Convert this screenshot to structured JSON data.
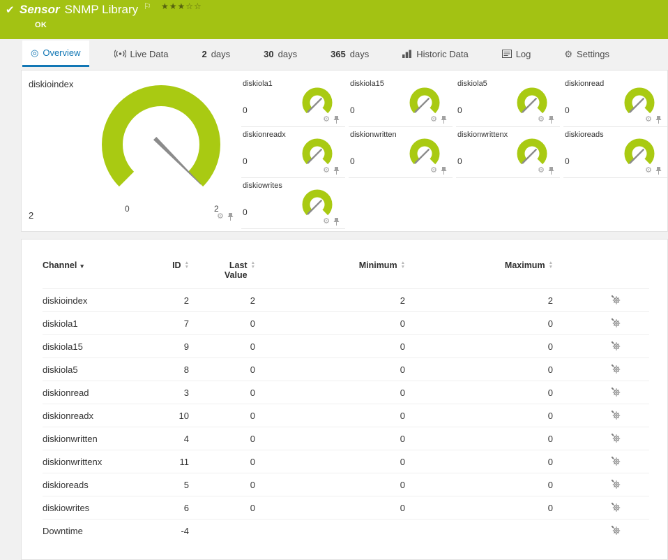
{
  "colors": {
    "header-bg": "#a3c213",
    "lime": "#a9ca12",
    "blue": "#1277b5"
  },
  "header": {
    "title_prefix": "Sensor",
    "title": "SNMP Library",
    "status": "OK",
    "rating_filled": 3,
    "rating_total": 5
  },
  "tabs": {
    "overview": "Overview",
    "live": "Live Data",
    "d2_num": "2",
    "d2": "days",
    "d30_num": "30",
    "d30": "days",
    "d365_num": "365",
    "d365": "days",
    "historic": "Historic Data",
    "log": "Log",
    "settings": "Settings"
  },
  "gauges": {
    "main": {
      "title": "diskioindex",
      "value": "2",
      "min": "0",
      "max": "2"
    },
    "small": [
      {
        "title": "diskiola1",
        "value": "0"
      },
      {
        "title": "diskiola15",
        "value": "0"
      },
      {
        "title": "diskiola5",
        "value": "0"
      },
      {
        "title": "diskionread",
        "value": "0"
      },
      {
        "title": "diskionreadx",
        "value": "0"
      },
      {
        "title": "diskionwritten",
        "value": "0"
      },
      {
        "title": "diskionwrittenx",
        "value": "0"
      },
      {
        "title": "diskioreads",
        "value": "0"
      },
      {
        "title": "diskiowrites",
        "value": "0"
      }
    ]
  },
  "table": {
    "columns": {
      "channel": "Channel",
      "id": "ID",
      "last": "Last Value",
      "min": "Minimum",
      "max": "Maximum"
    },
    "rows": [
      {
        "channel": "diskioindex",
        "id": "2",
        "last": "2",
        "min": "2",
        "max": "2"
      },
      {
        "channel": "diskiola1",
        "id": "7",
        "last": "0",
        "min": "0",
        "max": "0"
      },
      {
        "channel": "diskiola15",
        "id": "9",
        "last": "0",
        "min": "0",
        "max": "0"
      },
      {
        "channel": "diskiola5",
        "id": "8",
        "last": "0",
        "min": "0",
        "max": "0"
      },
      {
        "channel": "diskionread",
        "id": "3",
        "last": "0",
        "min": "0",
        "max": "0"
      },
      {
        "channel": "diskionreadx",
        "id": "10",
        "last": "0",
        "min": "0",
        "max": "0"
      },
      {
        "channel": "diskionwritten",
        "id": "4",
        "last": "0",
        "min": "0",
        "max": "0"
      },
      {
        "channel": "diskionwrittenx",
        "id": "11",
        "last": "0",
        "min": "0",
        "max": "0"
      },
      {
        "channel": "diskioreads",
        "id": "5",
        "last": "0",
        "min": "0",
        "max": "0"
      },
      {
        "channel": "diskiowrites",
        "id": "6",
        "last": "0",
        "min": "0",
        "max": "0"
      },
      {
        "channel": "Downtime",
        "id": "-4",
        "last": "",
        "min": "",
        "max": ""
      }
    ]
  }
}
